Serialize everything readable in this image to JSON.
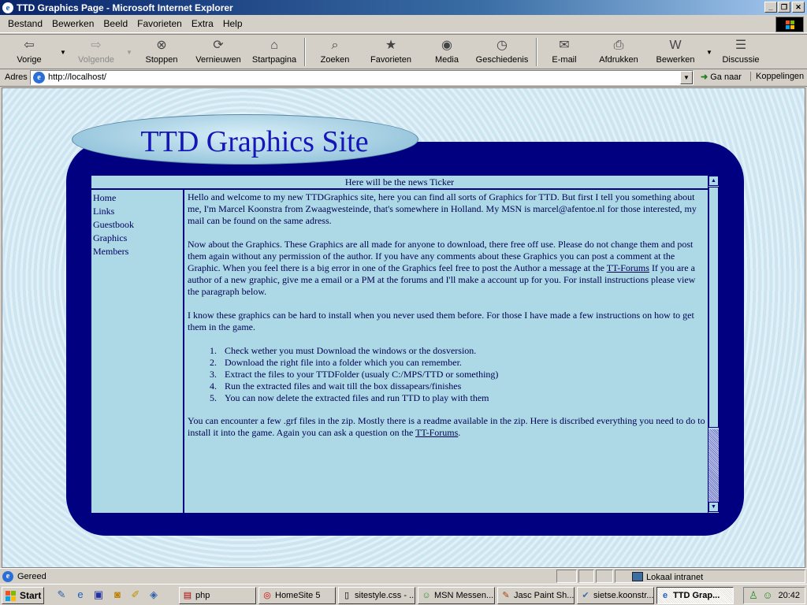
{
  "window": {
    "title": "TTD Graphics Page - Microsoft Internet Explorer"
  },
  "menu": [
    "Bestand",
    "Bewerken",
    "Beeld",
    "Favorieten",
    "Extra",
    "Help"
  ],
  "toolbar": {
    "back": "Vorige",
    "forward": "Volgende",
    "stop": "Stoppen",
    "refresh": "Vernieuwen",
    "home": "Startpagina",
    "search": "Zoeken",
    "favorites": "Favorieten",
    "media": "Media",
    "history": "Geschiedenis",
    "mail": "E-mail",
    "print": "Afdrukken",
    "edit": "Bewerken",
    "discuss": "Discussie"
  },
  "address": {
    "label": "Adres",
    "url": "http://localhost/",
    "go": "Ga naar",
    "links": "Koppelingen"
  },
  "page": {
    "site_title": "TTD Graphics Site",
    "ticker": "Here will be the news Ticker",
    "nav": [
      "Home",
      "Links",
      "Guestbook",
      "Graphics",
      "Members"
    ],
    "p1": "Hello and welcome to my new TTDGraphics site, here you can find all sorts of Graphics for TTD. But first I tell you something about me, I'm Marcel Koonstra from Zwaagwesteinde, that's somewhere in Holland. My MSN is marcel@afentoe.nl for those interested, my mail can be found on the same adress.",
    "p2_a": "Now about the Graphics. These Graphics are all made for anyone to download, there free off use. Please do not change them and post them again without any permission of the author. If you have any comments about these Graphics you can post a comment at the Graphic. When you feel there is a big error in one of the Graphics feel free to post the Author a message at the ",
    "p2_link": "TT-Forums",
    "p2_b": " If you are a author of a new graphic, give me a email or a PM at the forums and I'll make a account up for you. For install instructions please view the paragraph below.",
    "p3": "I know these graphics can be hard to install when you never used them before. For those I have made a few instructions on how to get them in the game.",
    "steps": [
      "Check wether you must Download the windows or the dosversion.",
      "Download the right file into a folder which you can remember.",
      "Extract the files to your TTDFolder (usualy C:/MPS/TTD or something)",
      "Run the extracted files and wait till the box dissapears/finishes",
      "You can now delete the extracted files and run TTD to play with them"
    ],
    "p4_a": "You can encounter a few .grf files in the zip. Mostly there is a readme available in the zip. Here is discribed everything you need to do to install it into the game. Again you can ask a question on the ",
    "p4_link": "TT-Forums",
    "p4_b": "."
  },
  "status": {
    "text": "Gereed",
    "zone": "Lokaal intranet"
  },
  "taskbar": {
    "start": "Start",
    "tasks": [
      "php",
      "HomeSite 5",
      "sitestyle.css - ...",
      "MSN Messen...",
      "Jasc Paint Sh...",
      "sietse.koonstr...",
      "TTD Grap..."
    ],
    "clock": "20:42"
  }
}
